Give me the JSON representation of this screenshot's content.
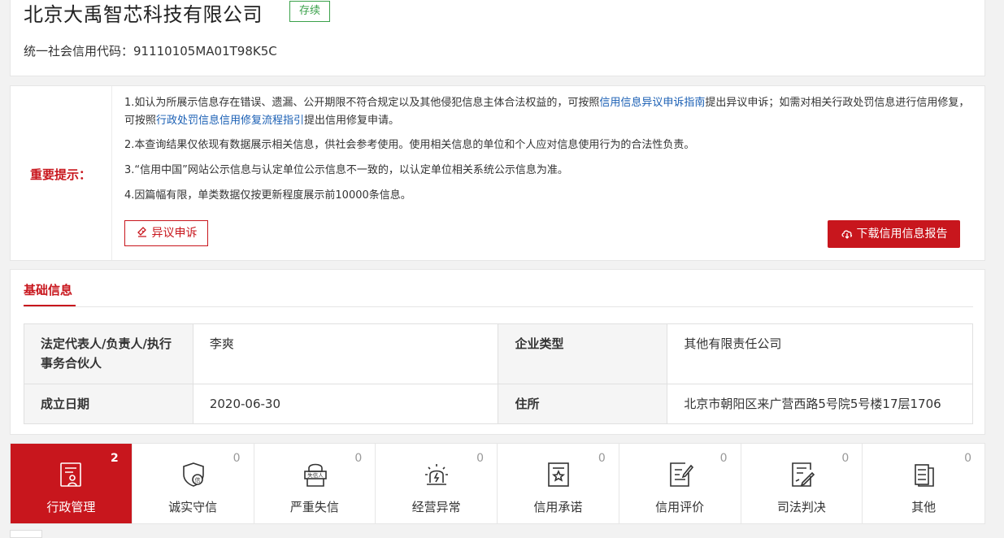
{
  "header": {
    "company_name": "北京大禹智芯科技有限公司",
    "status": "存续",
    "credit_code": "统一社会信用代码：91110105MA01T98K5C"
  },
  "notice": {
    "label": "重要提示：",
    "line1_a": "1.如认为所展示信息存在错误、遗漏、公开期限不符合规定以及其他侵犯信息主体合法权益的，可按照",
    "line1_link1": "信用信息异议申诉指南",
    "line1_b": "提出异议申诉；如需对相关行政处罚信息进行信用修复，可按照",
    "line1_link2": "行政处罚信息信用修复流程指引",
    "line1_c": "提出信用修复申请。",
    "line2": "2.本查询结果仅依现有数据展示相关信息，供社会参考使用。使用相关信息的单位和个人应对信息使用行为的合法性负责。",
    "line3": "3.“信用中国”网站公示信息与认定单位公示信息不一致的，以认定单位相关系统公示信息为准。",
    "line4": "4.因篇幅有限，单类数据仅按更新程度展示前10000条信息。",
    "appeal_label": "异议申诉",
    "download_label": "下载信用信息报告"
  },
  "basic": {
    "title": "基础信息",
    "rows": [
      {
        "k1": "法定代表人/负责人/执行事务合伙人",
        "v1": "李爽",
        "k2": "企业类型",
        "v2": "其他有限责任公司"
      },
      {
        "k1": "成立日期",
        "v1": "2020-06-30",
        "k2": "住所",
        "v2": "北京市朝阳区来广营西路5号院5号楼17层1706"
      }
    ]
  },
  "categories": [
    {
      "label": "行政管理",
      "count": "2",
      "icon": "admin-management-icon"
    },
    {
      "label": "诚实守信",
      "count": "0",
      "icon": "honesty-shield-icon"
    },
    {
      "label": "严重失信",
      "count": "0",
      "icon": "dishonest-person-icon"
    },
    {
      "label": "经营异常",
      "count": "0",
      "icon": "business-abnormal-icon"
    },
    {
      "label": "信用承诺",
      "count": "0",
      "icon": "credit-commitment-icon"
    },
    {
      "label": "信用评价",
      "count": "0",
      "icon": "credit-evaluation-icon"
    },
    {
      "label": "司法判决",
      "count": "0",
      "icon": "judicial-judgment-icon"
    },
    {
      "label": "其他",
      "count": "0",
      "icon": "other-icon"
    }
  ],
  "icon_sub": {
    "shield_char": "信",
    "dishonest_text": "失信人"
  },
  "colors": {
    "brand_red": "#c8161d",
    "status_green": "#3aa14a",
    "link_blue": "#1a5fb4"
  }
}
